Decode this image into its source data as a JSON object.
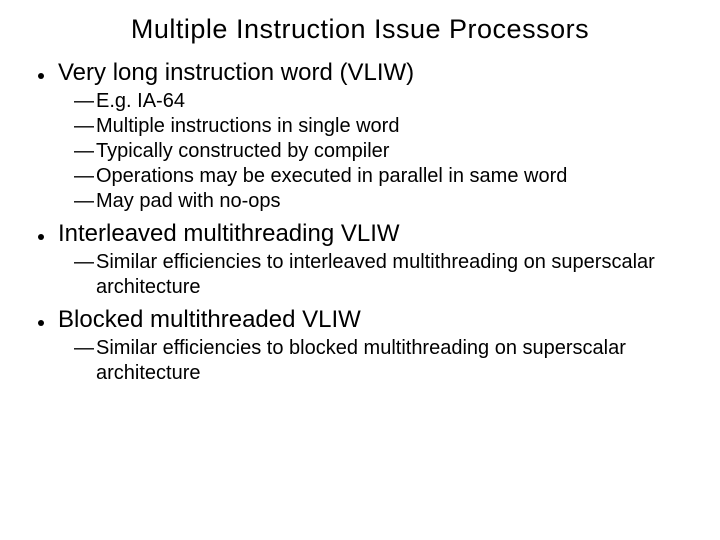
{
  "title": "Multiple Instruction Issue Processors",
  "sections": [
    {
      "heading": "Very long instruction word (VLIW)",
      "points": [
        "E.g. IA-64",
        "Multiple instructions in single word",
        "Typically constructed by compiler",
        "Operations may be executed in parallel in same word",
        "May pad with no-ops"
      ]
    },
    {
      "heading": "Interleaved multithreading VLIW",
      "points": [
        "Similar efficiencies to interleaved multithreading on superscalar architecture"
      ]
    },
    {
      "heading": "Blocked multithreaded VLIW",
      "points": [
        "Similar efficiencies to blocked multithreading on superscalar architecture"
      ]
    }
  ],
  "dash": "—"
}
